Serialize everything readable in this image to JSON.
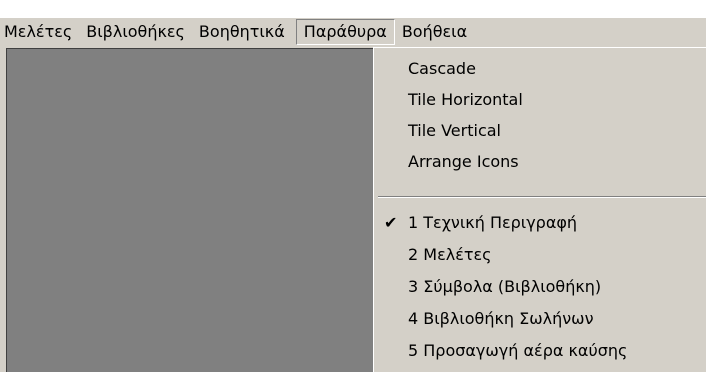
{
  "menubar": {
    "items": [
      {
        "label": "Μελέτες"
      },
      {
        "label": "Βιβλιοθήκες"
      },
      {
        "label": "Βοηθητικά"
      },
      {
        "label": "Παράθυρα"
      },
      {
        "label": "Βοήθεια"
      }
    ]
  },
  "windows_menu": {
    "arrange_items": [
      {
        "label": "Cascade"
      },
      {
        "label": "Tile Horizontal"
      },
      {
        "label": "Tile Vertical"
      },
      {
        "label": "Arrange Icons"
      }
    ],
    "window_list": [
      {
        "label": "1 Τεχνική Περιγραφή",
        "checked": true
      },
      {
        "label": "2 Μελέτες",
        "checked": false
      },
      {
        "label": "3 Σύμβολα (Βιβλιοθήκη)",
        "checked": false
      },
      {
        "label": "4 Βιβλιοθήκη Σωλήνων",
        "checked": false
      },
      {
        "label": "5 Προσαγωγή αέρα καύσης",
        "checked": false
      }
    ]
  },
  "colors": {
    "menu_bg": "#d4d0c8",
    "mdi_bg": "#808080"
  }
}
